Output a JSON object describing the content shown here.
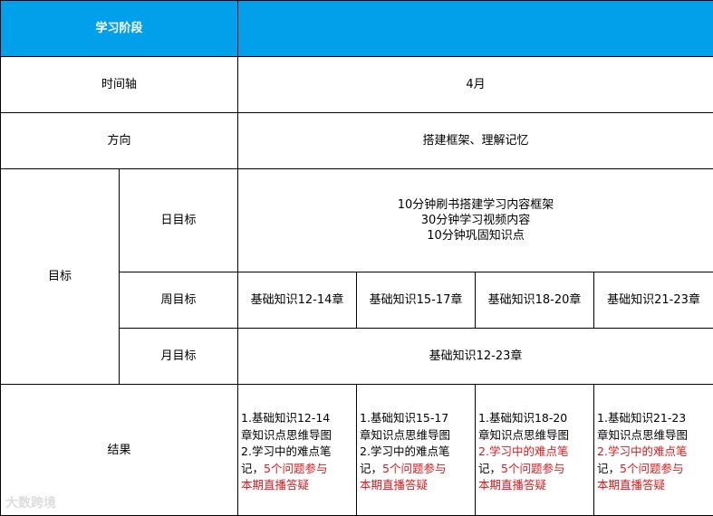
{
  "header": {
    "label": "学习阶段",
    "value": ""
  },
  "timeline": {
    "label": "时间轴",
    "value": "4月"
  },
  "direction": {
    "label": "方向",
    "value": "搭建框架、理解记忆"
  },
  "goals": {
    "label": "目标",
    "daily": {
      "label": "日目标",
      "lines": [
        "10分钟刷书搭建学习内容框架",
        "30分钟学习视频内容",
        "10分钟巩固知识点"
      ]
    },
    "weekly": {
      "label": "周目标",
      "items": [
        "基础知识12-14章",
        "基础知识15-17章",
        "基础知识18-20章",
        "基础知识21-23章"
      ]
    },
    "monthly": {
      "label": "月目标",
      "value": "基础知识12-23章"
    }
  },
  "results": {
    "label": "结果",
    "items": [
      {
        "l1": "1.基础知识12-14",
        "l2": "章知识点思维导图",
        "l3": "2.学习中的难点笔",
        "l4": "记，",
        "l4red": "5个问题参与",
        "l5": "本期直播答疑",
        "l3red": false
      },
      {
        "l1": "1.基础知识15-17",
        "l2": "章知识点思维导图",
        "l3": "2.学习中的难点笔",
        "l4": "记，",
        "l4red": "5个问题参与",
        "l5": "本期直播答疑",
        "l3red": false
      },
      {
        "l1": "1.基础知识18-20",
        "l2": "章知识点思维导图",
        "l3": "2.学习中的难点笔",
        "l4": "记，",
        "l4red": "5个问题参与",
        "l5": "本期直播答疑",
        "l3red": true
      },
      {
        "l1": "1.基础知识21-23",
        "l2": "章知识点思维导图",
        "l3": "2.学习中的难点笔",
        "l4": "记，",
        "l4red": "5个问题参与",
        "l5": "本期直播答疑",
        "l3red": true
      }
    ]
  },
  "watermark": "大数跨境",
  "colors": {
    "header": "#00a1ea",
    "highlight": "#e0191b"
  }
}
